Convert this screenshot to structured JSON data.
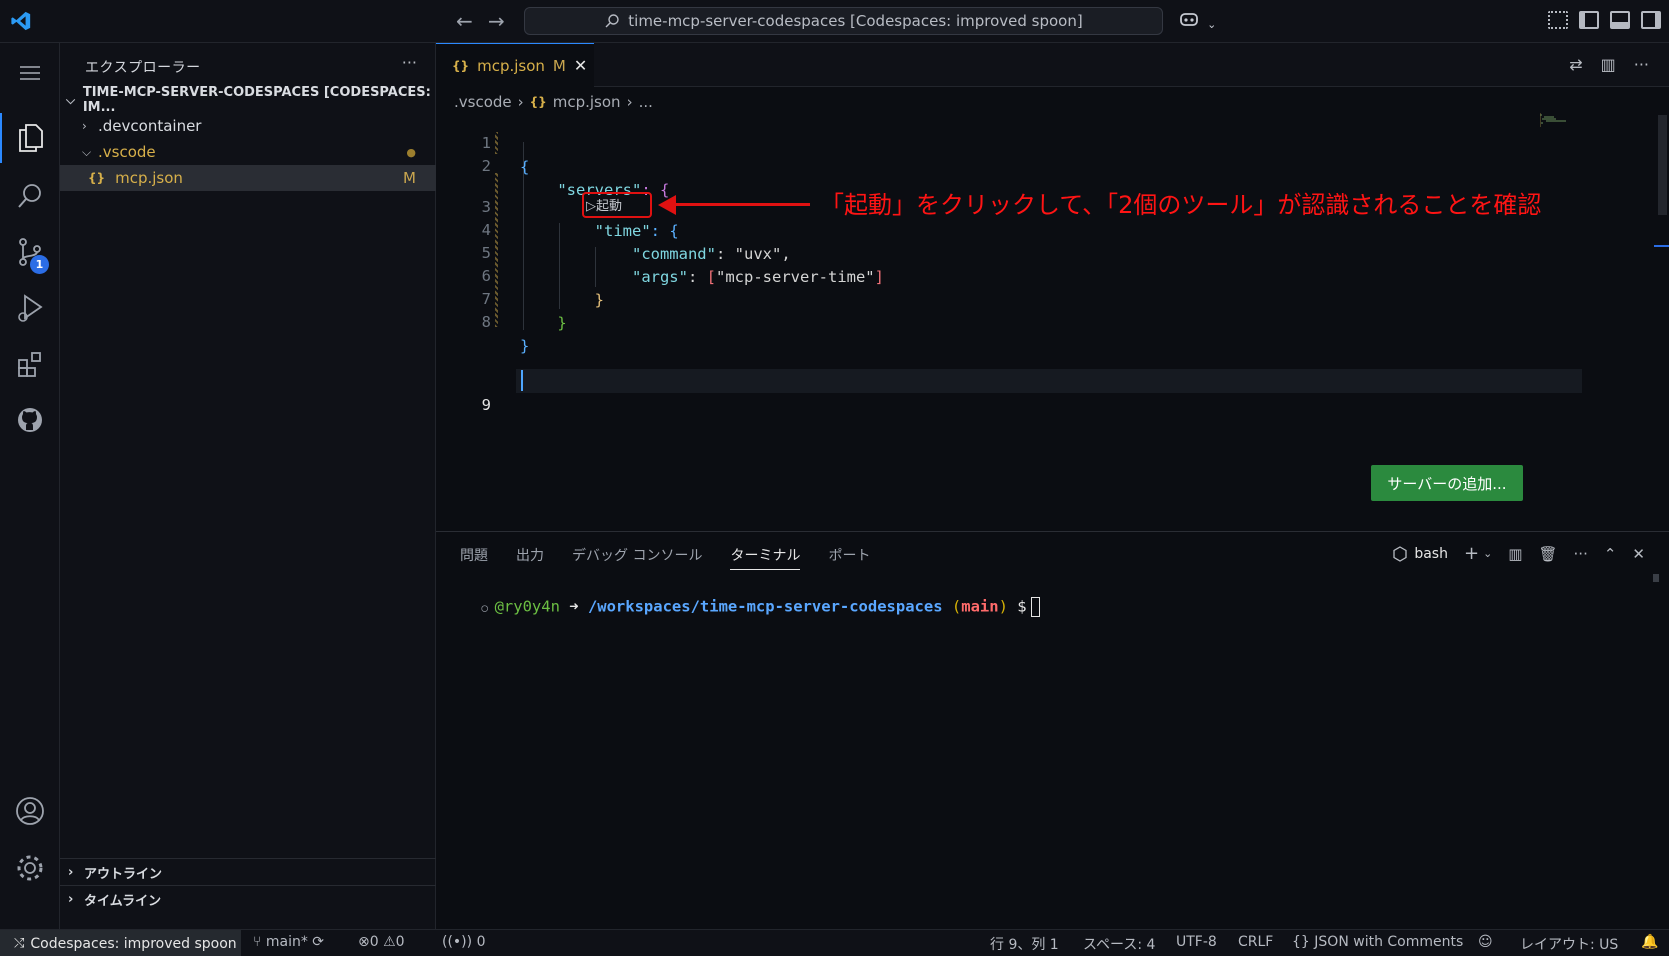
{
  "titlebar": {
    "search_text": "time-mcp-server-codespaces [Codespaces: improved spoon]",
    "copilot_icon": "copilot-icon"
  },
  "activity": {
    "source_control_badge": "1"
  },
  "sidebar": {
    "title": "エクスプローラー",
    "more": "···",
    "root": "TIME-MCP-SERVER-CODESPACES [CODESPACES: IM...",
    "items": [
      {
        "label": ".devcontainer"
      },
      {
        "label": ".vscode",
        "status": "●"
      },
      {
        "label": "mcp.json",
        "status": "M"
      }
    ],
    "sections": [
      {
        "label": "アウトライン"
      },
      {
        "label": "タイムライン"
      }
    ]
  },
  "editor": {
    "tab": {
      "label": "mcp.json",
      "status": "M",
      "icon": "{}"
    },
    "breadcrumb": [
      ".vscode",
      "{}",
      "mcp.json",
      "..."
    ],
    "line_numbers": [
      "1",
      "2",
      "3",
      "4",
      "5",
      "6",
      "7",
      "8",
      "9"
    ],
    "code": {
      "l1": "{",
      "l2_key": "\"servers\"",
      "l2_rest": ": {",
      "l3_key": "\"time\"",
      "l3_rest": ": {",
      "l4_key": "\"command\"",
      "l4_colon": ": ",
      "l4_val": "\"uvx\"",
      "l4_comma": ",",
      "l5_key": "\"args\"",
      "l5_colon": ": ",
      "l5_open": "[",
      "l5_val": "\"mcp-server-time\"",
      "l5_close": "]",
      "l6": "}",
      "l7": "}",
      "l8": "}"
    },
    "codelens": "▷起動",
    "annotation": "「起動」をクリックして、「2個のツール」が認識されることを確認",
    "add_server_button": "サーバーの追加..."
  },
  "panel": {
    "tabs": [
      "問題",
      "出力",
      "デバッグ コンソール",
      "ターミナル",
      "ポート"
    ],
    "active_tab": "ターミナル",
    "shell": "bash",
    "terminal": {
      "user": "@ry0y4n",
      "arrow": "➜",
      "path": "/workspaces/time-mcp-server-codespaces",
      "branch_open": "(",
      "branch": "main",
      "branch_close": ")",
      "prompt": "$"
    }
  },
  "statusbar": {
    "remote": "Codespaces: improved spoon",
    "branch": "main*",
    "errors": "0",
    "warnings": "0",
    "ports": "0",
    "position": "行 9、列 1",
    "spaces": "スペース: 4",
    "encoding": "UTF-8",
    "eol": "CRLF",
    "language": "JSON with Comments",
    "layout": "レイアウト: US"
  },
  "colors": {
    "accent": "#2b89ff",
    "annotation": "#e01111",
    "add_button": "#2b8a3e"
  }
}
